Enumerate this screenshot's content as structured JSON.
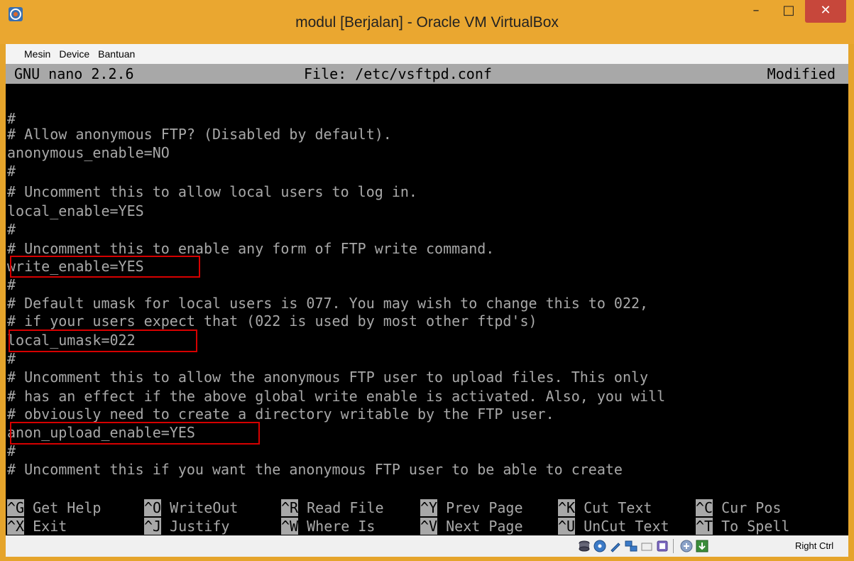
{
  "window": {
    "title": "modul [Berjalan] - Oracle VM VirtualBox",
    "minimize": "–",
    "maximize": "□",
    "close": "✕"
  },
  "menu": {
    "items": [
      {
        "label": "Mesin"
      },
      {
        "label": "Device"
      },
      {
        "label": "Bantuan"
      }
    ]
  },
  "nano": {
    "version": "GNU nano 2.2.6",
    "file": "File: /etc/vsftpd.conf",
    "state": "Modified"
  },
  "editor": {
    "lines": [
      "",
      "#",
      "# Allow anonymous FTP? (Disabled by default).",
      "anonymous_enable=NO",
      "#",
      "# Uncomment this to allow local users to log in.",
      "local_enable=YES",
      "#",
      "# Uncomment this to enable any form of FTP write command.",
      "write_enable=YES",
      "#",
      "# Default umask for local users is 077. You may wish to change this to 022,",
      "# if your users expect that (022 is used by most other ftpd's)",
      "local_umask=022",
      "#",
      "# Uncomment this to allow the anonymous FTP user to upload files. This only",
      "# has an effect if the above global write enable is activated. Also, you will",
      "# obviously need to create a directory writable by the FTP user.",
      "anon_upload_enable=YES",
      "#",
      "# Uncomment this if you want the anonymous FTP user to be able to create"
    ]
  },
  "shortcuts": {
    "row1": [
      {
        "key": "^G",
        "label": " Get Help "
      },
      {
        "key": "^O",
        "label": " WriteOut "
      },
      {
        "key": "^R",
        "label": " Read File "
      },
      {
        "key": "^Y",
        "label": " Prev Page "
      },
      {
        "key": "^K",
        "label": " Cut Text  "
      },
      {
        "key": "^C",
        "label": " Cur Pos"
      }
    ],
    "row2": [
      {
        "key": "^X",
        "label": " Exit     "
      },
      {
        "key": "^J",
        "label": " Justify  "
      },
      {
        "key": "^W",
        "label": " Where Is  "
      },
      {
        "key": "^V",
        "label": " Next Page "
      },
      {
        "key": "^U",
        "label": " UnCut Text"
      },
      {
        "key": "^T",
        "label": " To Spell"
      }
    ]
  },
  "status": {
    "host_key": "Right Ctrl",
    "icons": [
      "hard-disk-icon",
      "optical-drive-icon",
      "usb-icon",
      "network-icon",
      "shared-folder-icon",
      "display-icon",
      "capture-icon",
      "arrow-down-icon"
    ]
  }
}
